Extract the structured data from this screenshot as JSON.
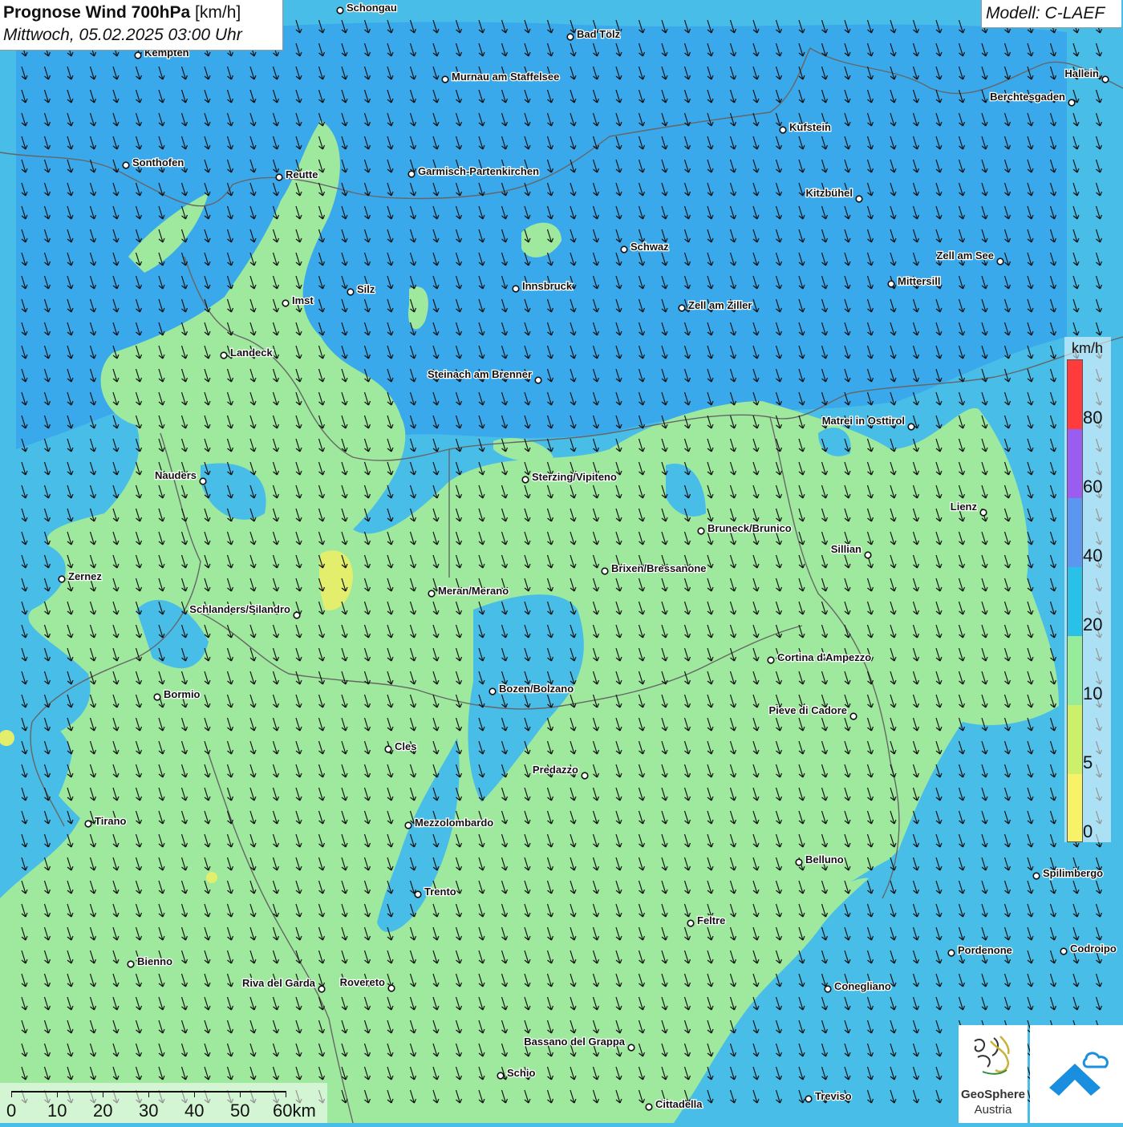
{
  "header": {
    "title_bold": "Prognose Wind 700hPa",
    "title_unit": "[km/h]",
    "subtitle": "Mittwoch, 05.02.2025 03:00 Uhr",
    "model": "Modell: C-LAEF"
  },
  "legend": {
    "unit": "km/h",
    "labels": [
      "80",
      "60",
      "40",
      "20",
      "10",
      "5",
      "0"
    ],
    "colors": [
      "#ff3b3b",
      "#9b5cf0",
      "#5b97f0",
      "#2ac1e8",
      "#96ec9a",
      "#cdf06a",
      "#f8f268"
    ]
  },
  "scale": {
    "labels": [
      "0",
      "10",
      "20",
      "30",
      "40",
      "50",
      "60km"
    ]
  },
  "logos": {
    "geosphere_line1": "GeoSphere",
    "geosphere_line2": "Austria"
  },
  "colors": {
    "sea_blue": "#48bde8",
    "land_blue": "#3aa9ec",
    "green": "#9ee99d",
    "yellow": "#e2ee6c",
    "arrow": "#111111",
    "border": "#666666"
  },
  "wind_arrow_direction": "towards south-southeast",
  "cities": [
    "Schongau",
    "Kempten",
    "Bad Tölz",
    "Murnau am Staffelsee",
    "Hallein",
    "Berchtesgaden",
    "Sonthofen",
    "Reutte",
    "Garmisch-Partenkirchen",
    "Kufstein",
    "Kitzbühel",
    "Schwaz",
    "Zell am See",
    "Mittersill",
    "Imst",
    "Silz",
    "Innsbruck",
    "Zell am Ziller",
    "Landeck",
    "Steinach am Brenner",
    "Matrei in Osttirol",
    "Nauders",
    "Sterzing/Vipiteno",
    "Lienz",
    "Bruneck/Brunico",
    "Sillian",
    "Brixen/Bressanone",
    "Zernez",
    "Meran/Merano",
    "Schlanders/Silandro",
    "Cortina d'Ampezzo",
    "Bozen/Bolzano",
    "Bormio",
    "Pieve di Cadore",
    "Cles",
    "Predazzo",
    "Tirano",
    "Mezzolombardo",
    "Belluno",
    "Spilimbergo",
    "Trento",
    "Feltre",
    "Pordenone",
    "Codroipo",
    "Bienno",
    "Riva del Garda",
    "Rovereto",
    "Conegliano",
    "Bassano del Grappa",
    "Schio",
    "Treviso",
    "Cittadella"
  ]
}
